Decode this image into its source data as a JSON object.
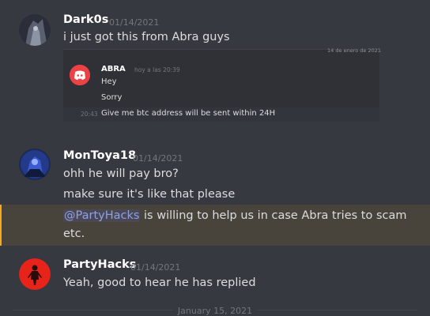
{
  "messages": [
    {
      "username": "Dark0s",
      "timestamp": "01/14/2021",
      "lines": [
        "i just got this from Abra guys"
      ]
    },
    {
      "username": "MonToya18",
      "timestamp": "01/14/2021",
      "lines": [
        "ohh he will pay bro?",
        "make sure it's like that please"
      ],
      "mention_line": {
        "mention": "@PartyHacks",
        "rest": " is willing to help us in case Abra tries to scam",
        "continuation": "etc."
      }
    },
    {
      "username": "PartyHacks",
      "timestamp": "01/14/2021",
      "lines": [
        "Yeah, good to hear he has replied"
      ]
    }
  ],
  "embedded_image": {
    "top_date": "14 de enero de 2021",
    "sender": "ABRA",
    "time": "hoy a las 20:39",
    "lines": [
      "Hey",
      "Sorry"
    ],
    "last_time": "20:43",
    "last_line": "Give me btc address will be sent within 24H",
    "icon": "discord-logo-icon",
    "accent_color": "#ed4245"
  },
  "date_divider": "January 15, 2021",
  "colors": {
    "background": "#36393f",
    "mention": "#8ea1e1",
    "highlight_bar": "#faa81a"
  }
}
